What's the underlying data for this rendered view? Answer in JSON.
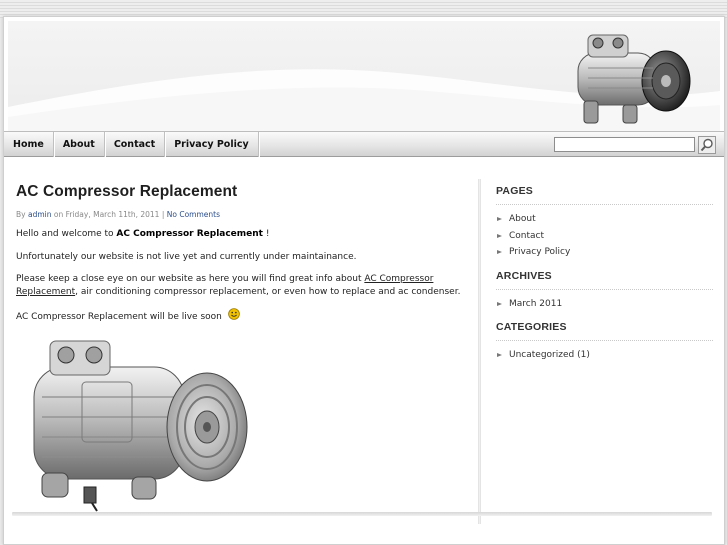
{
  "nav": {
    "items": [
      "Home",
      "About",
      "Contact",
      "Privacy Policy"
    ]
  },
  "search": {
    "value": "",
    "placeholder": ""
  },
  "post": {
    "title": "AC Compressor Replacement",
    "meta": {
      "by": "By",
      "author": "admin",
      "on": "on Friday, March 11th, 2011 |",
      "comments": "No Comments"
    },
    "p1_before": "Hello and welcome to ",
    "p1_bold": "AC Compressor Replacement",
    "p1_after": " !",
    "p2": "Unfortunately our website is not live yet and currently under maintainance.",
    "p3_before": "Please keep a close eye on our website as here you will find great info about ",
    "p3_link": "AC Compressor Replacement",
    "p3_after": ", air conditioning compressor replacement, or even how to replace and ac condenser.",
    "p4": "AC Compressor Replacement will be live soon"
  },
  "sidebar": {
    "pages": {
      "title": "PAGES",
      "items": [
        "About",
        "Contact",
        "Privacy Policy"
      ]
    },
    "archives": {
      "title": "ARCHIVES",
      "items": [
        "March 2011"
      ]
    },
    "categories": {
      "title": "CATEGORIES",
      "items": [
        "Uncategorized (1)"
      ]
    }
  },
  "colors": {
    "link": "#2d4f8b",
    "page_bg": "#e9e9e9",
    "accent_smiley": "#f2c200"
  },
  "icons": [
    "search-icon",
    "smiley-icon",
    "bullet-arrow-icon"
  ]
}
